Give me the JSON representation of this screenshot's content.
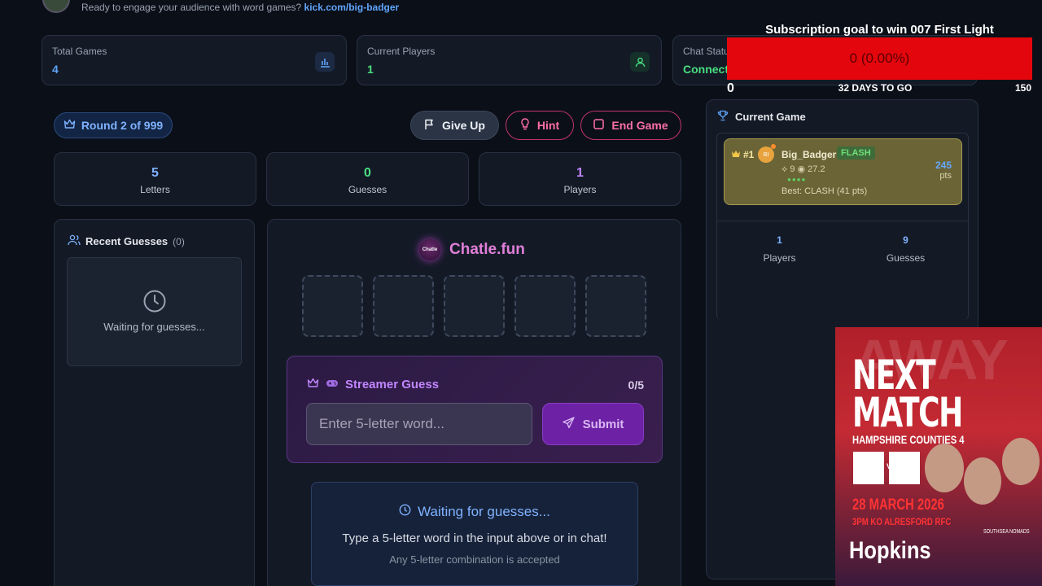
{
  "header": {
    "tagline": "Ready to engage your audience with word games?",
    "link": "kick.com/big-badger"
  },
  "stats": [
    {
      "label": "Total Games",
      "value": "4",
      "icon": "bar-chart-icon"
    },
    {
      "label": "Current Players",
      "value": "1",
      "icon": "user-icon"
    },
    {
      "label": "Chat Status",
      "value": "Connected",
      "icon": "signal-icon"
    }
  ],
  "round": {
    "label": "Round 2 of 999"
  },
  "actions": {
    "give_up": "Give Up",
    "hint": "Hint",
    "end_game": "End Game"
  },
  "minis": [
    {
      "value": "5",
      "label": "Letters",
      "color": "#7fb2ff"
    },
    {
      "value": "0",
      "label": "Guesses",
      "color": "#4ade80"
    },
    {
      "value": "1",
      "label": "Players",
      "color": "#c084fc"
    }
  ],
  "recent": {
    "title": "Recent Guesses",
    "count": "(0)",
    "waiting": "Waiting for guesses..."
  },
  "game": {
    "brand": "Chatle.fun",
    "logo_text": "Chatle",
    "streamer_title": "Streamer Guess",
    "streamer_count": "0/5",
    "input_placeholder": "Enter 5-letter word...",
    "submit": "Submit",
    "status_title": "Waiting for guesses...",
    "status_line1": "Type a 5-letter word in the input above or in chat!",
    "status_line2": "Any 5-letter combination is accepted"
  },
  "current": {
    "title": "Current Game",
    "player": {
      "rank": "#1",
      "avatar": "BI",
      "name": "Big_Badger",
      "tag": "FLASH",
      "meta": "⟡ 9 ◉ 27.2",
      "dots": "●●●●",
      "best": "Best: CLASH (41 pts)",
      "points": "245",
      "points_unit": "pts"
    },
    "summary": [
      {
        "value": "1",
        "label": "Players"
      },
      {
        "value": "9",
        "label": "Guesses"
      }
    ]
  },
  "subscription": {
    "title": "Subscription goal to win 007 First Light",
    "progress": "0 (0.00%)",
    "progress_fraction": 0,
    "min": "0",
    "days": "32 DAYS TO GO",
    "max": "150"
  },
  "poster": {
    "bg_word": "AWAY",
    "headline": "NEXT MATCH",
    "competition": "HAMPSHIRE COUNTIES 4",
    "vs": "VS",
    "date": "28 MARCH 2026",
    "kickoff": "3PM KO   ALRESFORD RFC",
    "sponsor": "Hopkins",
    "club": "SOUTHSEA NOMADS"
  }
}
